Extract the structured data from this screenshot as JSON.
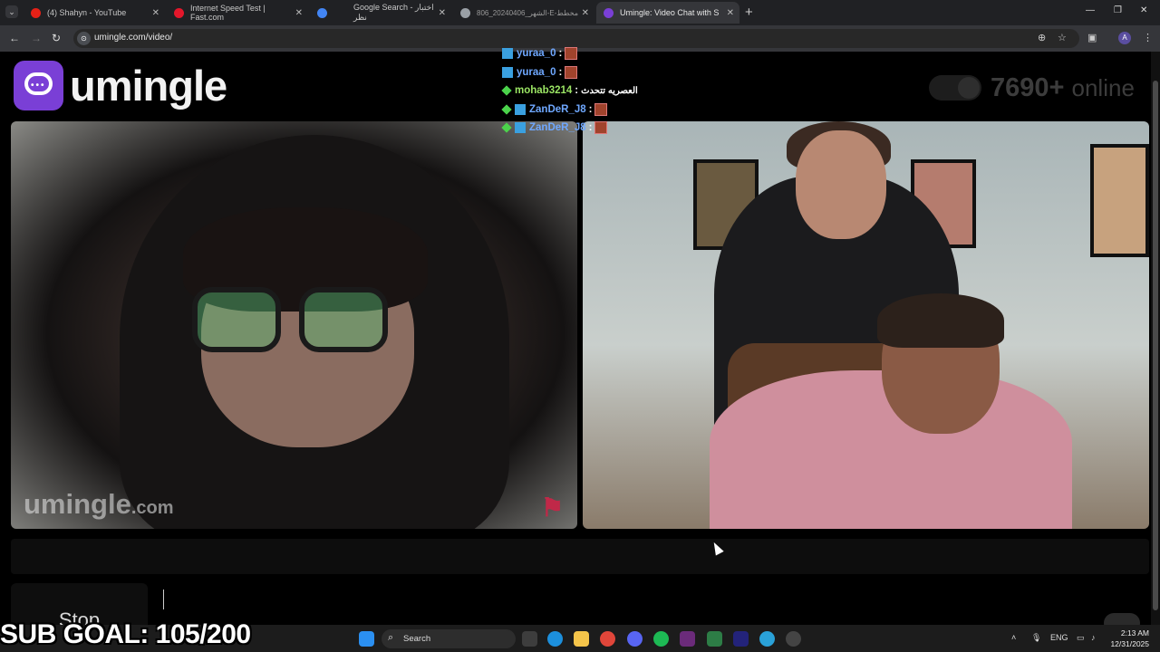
{
  "browser": {
    "tabs": [
      {
        "title": "(4) Shahyn - YouTube",
        "fav_color": "#e62117"
      },
      {
        "title": "Internet Speed Test | Fast.com",
        "fav_color": "#e4172b"
      },
      {
        "title": "Google Search - اختبار نظر",
        "fav_color": "#4285f4"
      },
      {
        "title": "806_20240406_الشهر-E-مخطط",
        "fav_color": "#9aa0a6"
      },
      {
        "title": "Umingle: Video Chat with S",
        "fav_color": "#7a3fd6",
        "active": true
      }
    ],
    "new_tab": "+",
    "url": "umingle.com/video/",
    "window_controls": {
      "minimize": "—",
      "maximize": "❐",
      "close": "✕"
    }
  },
  "site": {
    "brand": "umingle",
    "online_count": "7690+",
    "online_label": "online",
    "watermark_main": "umingle",
    "watermark_domain": ".com",
    "stop_label": "Stop"
  },
  "chat_overlay": [
    {
      "user": "yuraa_0",
      "style": "blue",
      "icon": true,
      "emote": true
    },
    {
      "user": "yuraa_0",
      "style": "blue",
      "icon": true,
      "emote": true
    },
    {
      "user": "mohab3214",
      "style": "green",
      "badge": true,
      "message": "العصريه تتحدث"
    },
    {
      "user": "ZanDeR_J8",
      "style": "blue",
      "badge": true,
      "icon": true,
      "emote": true
    },
    {
      "user": "ZanDeR_J8",
      "style": "blue",
      "badge": true,
      "icon": true,
      "emote": true
    }
  ],
  "stream_overlay": {
    "sub_goal": "SUB GOAL: 105/200"
  },
  "taskbar": {
    "search_label": "Search",
    "language": "ENG",
    "time": "2:13 AM",
    "date": "12/31/2025",
    "apps": [
      "windows-icon",
      "search-icon",
      "task-view-icon",
      "file-explorer-icon",
      "edge-icon",
      "folder-icon",
      "chrome-icon",
      "discord-icon",
      "spotify-icon",
      "premiere-icon",
      "telegram-icon",
      "obs-icon"
    ]
  }
}
